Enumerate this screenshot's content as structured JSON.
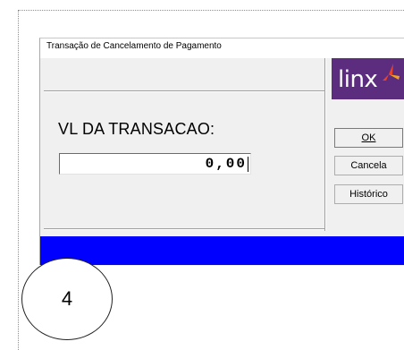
{
  "dialog": {
    "title": "Transação de Cancelamento de Pagamento"
  },
  "form": {
    "label": "VL DA TRANSACAO:",
    "value": "0,00"
  },
  "logo": {
    "text": "linx",
    "brand_color": "#5c2d7e",
    "accent_colors": [
      "#e8432b",
      "#f4a11c"
    ]
  },
  "buttons": {
    "ok": "OK",
    "cancel": "Cancela",
    "history": "Histórico"
  },
  "status_bar": {
    "color": "#0000ff"
  },
  "annotation": {
    "step": "4"
  }
}
